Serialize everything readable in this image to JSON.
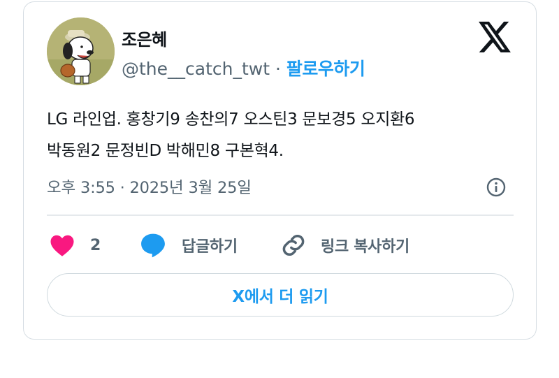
{
  "author": {
    "name": "조은혜",
    "handle": "@the__catch_twt",
    "separator": "·",
    "follow_label": "팔로우하기"
  },
  "tweet": {
    "line1": "LG 라인업. 홍창기9 송찬의7 오스틴3 문보경5 오지환6",
    "line2": "박동원2 문정빈D 박해민8 구본혁4.",
    "timestamp": "오후 3:55 · 2025년 3월 25일"
  },
  "actions": {
    "like_count": "2",
    "reply_label": "답글하기",
    "copy_link_label": "링크 복사하기"
  },
  "read_more_label": "X에서 더 읽기",
  "colors": {
    "accent": "#1d9bf0",
    "like": "#f91880",
    "text": "#0f1419",
    "secondary": "#536471",
    "border": "#d6dde3"
  },
  "icons": {
    "logo": "x-logo-icon",
    "info": "info-icon",
    "like": "heart-icon",
    "reply": "speech-bubble-icon",
    "copy": "link-icon"
  }
}
